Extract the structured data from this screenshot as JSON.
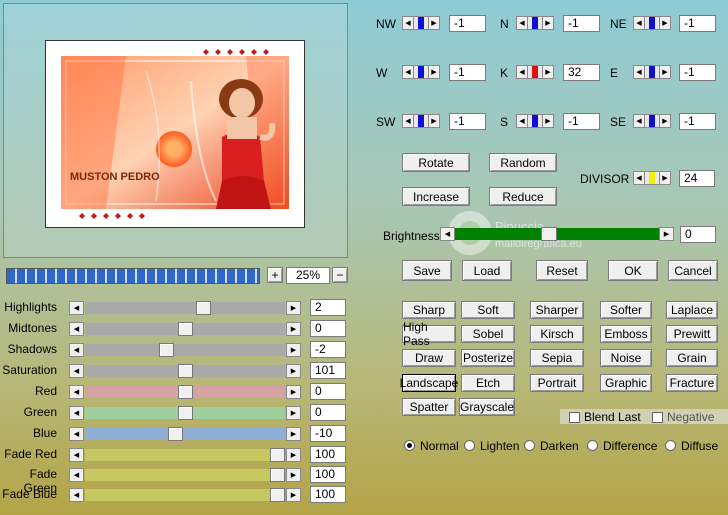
{
  "preview": {
    "image_text": "MUSTON PEDRO"
  },
  "zoom": {
    "plus_label": "+",
    "value": "25%",
    "minus_label": "−"
  },
  "adjust_sliders": [
    {
      "label": "Highlights",
      "value": "2",
      "level": 0.6,
      "track_color": "#a9a9a9"
    },
    {
      "label": "Midtones",
      "value": "0",
      "level": 0.5,
      "track_color": "#a9a9a9"
    },
    {
      "label": "Shadows",
      "value": "-2",
      "level": 0.4,
      "track_color": "#a9a9a9"
    },
    {
      "label": "Saturation",
      "value": "101",
      "level": 0.5,
      "track_color": "#a9a9a9"
    },
    {
      "label": "Red",
      "value": "0",
      "level": 0.5,
      "track_color": "#d5a3a3"
    },
    {
      "label": "Green",
      "value": "0",
      "level": 0.5,
      "track_color": "#9fcf9f"
    },
    {
      "label": "Blue",
      "value": "-10",
      "level": 0.45,
      "track_color": "#8fb0d6"
    },
    {
      "label": "Fade Red",
      "value": "100",
      "level": 1.0,
      "track_color": "#c8c862"
    },
    {
      "label": "Fade Green",
      "value": "100",
      "level": 1.0,
      "track_color": "#c8c862"
    },
    {
      "label": "Fade Blue",
      "value": "100",
      "level": 1.0,
      "track_color": "#c8c862"
    }
  ],
  "matrix": [
    {
      "label": "NW",
      "value": "-1",
      "marker": "#1010d0"
    },
    {
      "label": "N",
      "value": "-1",
      "marker": "#1010d0"
    },
    {
      "label": "NE",
      "value": "-1",
      "marker": "#1010d0"
    },
    {
      "label": "W",
      "value": "-1",
      "marker": "#1010d0"
    },
    {
      "label": "K",
      "value": "32",
      "marker": "#e01010"
    },
    {
      "label": "E",
      "value": "-1",
      "marker": "#1010d0"
    },
    {
      "label": "SW",
      "value": "-1",
      "marker": "#1010d0"
    },
    {
      "label": "S",
      "value": "-1",
      "marker": "#1010d0"
    },
    {
      "label": "SE",
      "value": "-1",
      "marker": "#1010d0"
    }
  ],
  "ops": {
    "rotate": "Rotate",
    "random": "Random",
    "increase": "Increase",
    "reduce": "Reduce"
  },
  "divisor": {
    "label": "DIVISOR",
    "value": "24",
    "marker": "#f0f000"
  },
  "brightness": {
    "label": "Brightness",
    "value": "0",
    "level": 0.5,
    "fill_color": "#008000"
  },
  "actions": {
    "save": "Save",
    "load": "Load",
    "reset": "Reset",
    "ok": "OK",
    "cancel": "Cancel"
  },
  "presets": [
    [
      "Sharp",
      "Soft",
      "Sharper",
      "Softer",
      "Laplace"
    ],
    [
      "High Pass",
      "Sobel",
      "Kirsch",
      "Emboss",
      "Prewitt"
    ],
    [
      "Draw",
      "Posterize",
      "Sepia",
      "Noise",
      "Grain"
    ],
    [
      "Landscape",
      "Etch",
      "Portrait",
      "Graphic",
      "Fracture"
    ],
    [
      "Spatter",
      "Grayscale"
    ]
  ],
  "checks": {
    "blend_last": "Blend Last",
    "negative": "Negative"
  },
  "modes": [
    {
      "label": "Normal",
      "selected": true
    },
    {
      "label": "Lighten",
      "selected": false
    },
    {
      "label": "Darken",
      "selected": false
    },
    {
      "label": "Difference",
      "selected": false
    },
    {
      "label": "Diffuse",
      "selected": false
    }
  ],
  "watermark": {
    "line1": "Pinuccia",
    "line2": "maildiregrafica.eu"
  }
}
